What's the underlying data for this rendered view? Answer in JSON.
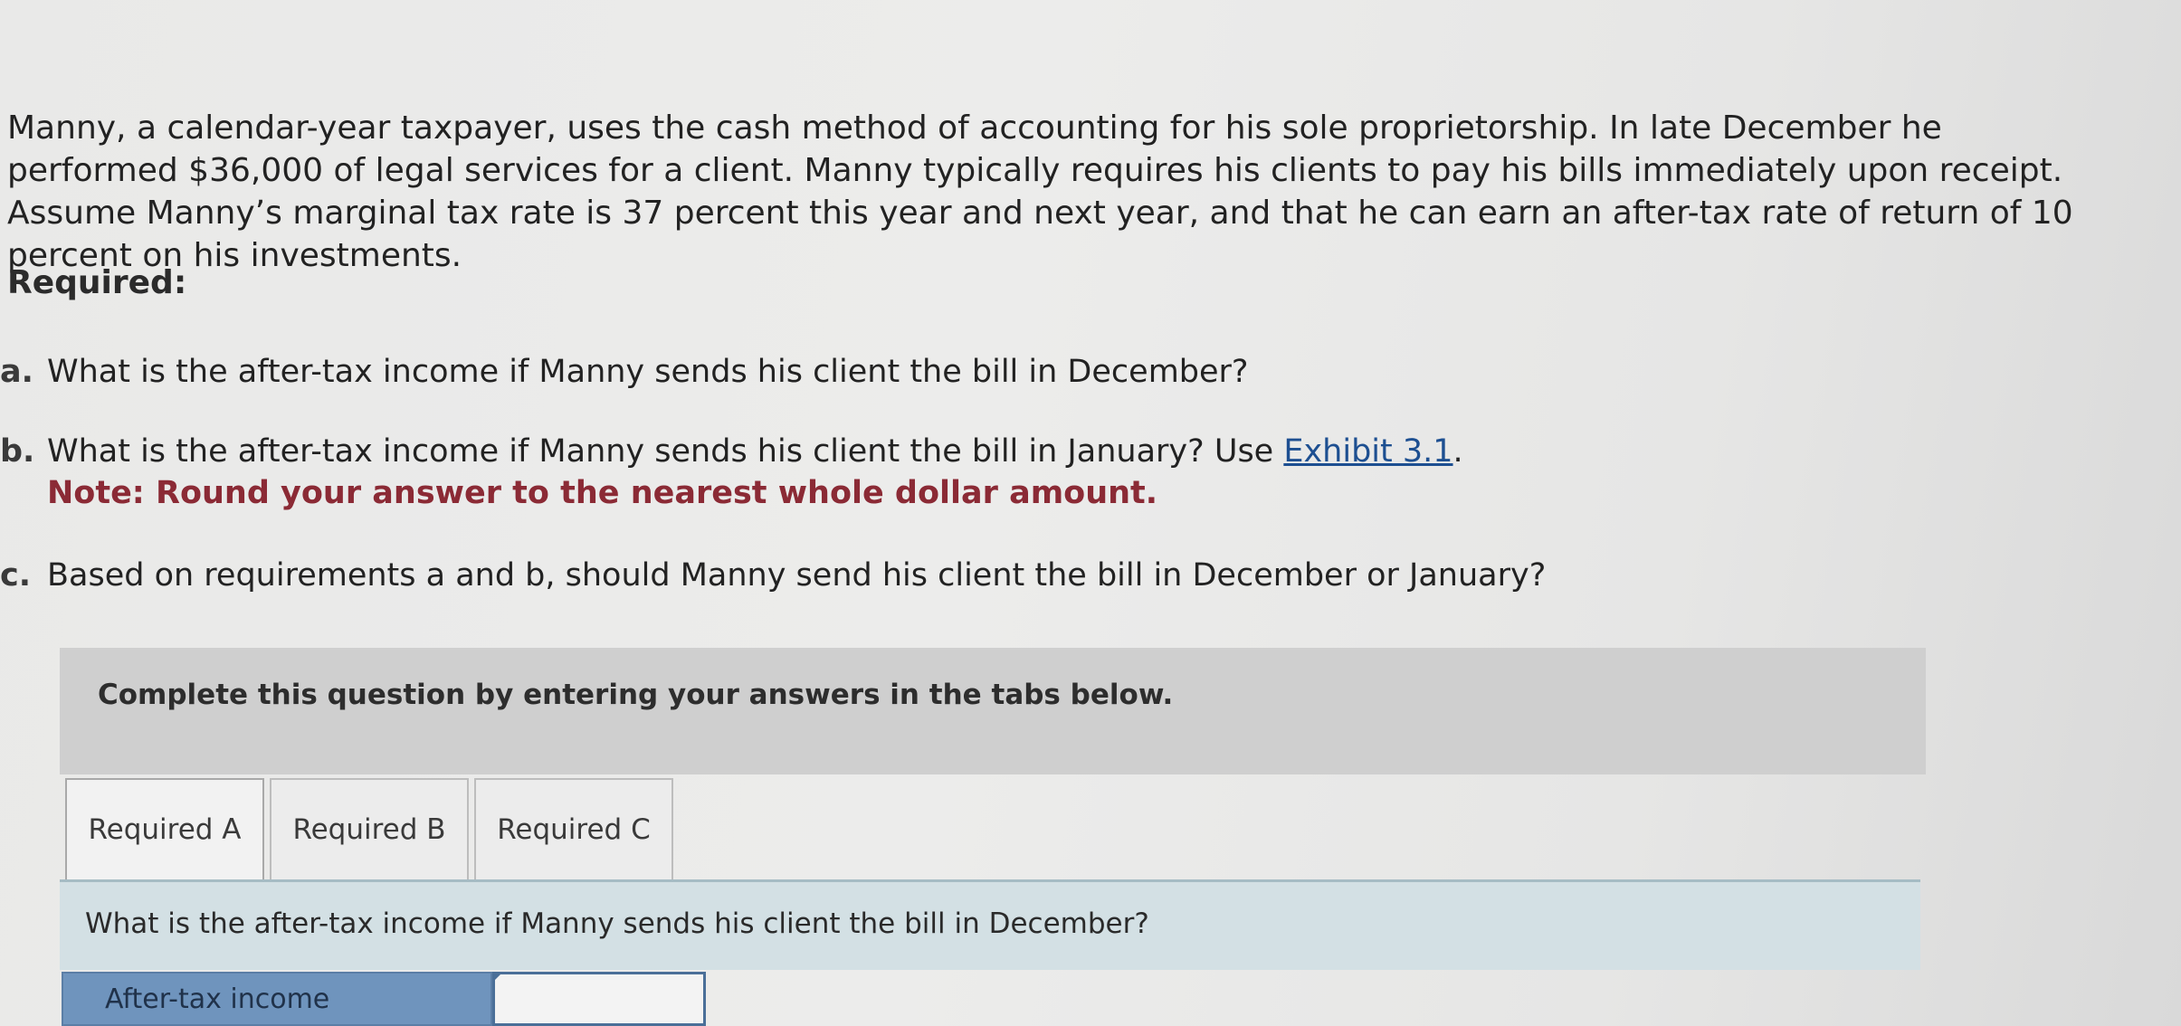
{
  "problem": {
    "intro": "Manny, a calendar-year taxpayer, uses the cash method of accounting for his sole proprietorship. In late December he performed $36,000 of legal services for a client. Manny typically requires his clients to pay his bills immediately upon receipt. Assume Manny’s marginal tax rate is 37 percent this year and next year, and that he can earn an after-tax rate of return of 10 percent on his investments.",
    "required_heading": "Required:",
    "items": [
      {
        "letter": "a.",
        "text": "What is the after-tax income if Manny sends his client the bill in December?"
      },
      {
        "letter": "b.",
        "text": "What is the after-tax income if Manny sends his client the bill in January? Use ",
        "link_text": "Exhibit 3.1",
        "after_link": ".",
        "note": "Note: Round your answer to the nearest whole dollar amount."
      },
      {
        "letter": "c.",
        "text": "Based on requirements a and b, should Manny send his client the bill in December or January?"
      }
    ]
  },
  "instruction": "Complete this question by entering your answers in the tabs below.",
  "tabs": [
    {
      "label": "Required A",
      "active": true
    },
    {
      "label": "Required B",
      "active": false
    },
    {
      "label": "Required C",
      "active": false
    }
  ],
  "question": "What is the after-tax income if Manny sends his client the bill in December?",
  "answer": {
    "label": "After-tax income",
    "value": ""
  },
  "colors": {
    "note": "#8b2a35",
    "link": "#1d4f91",
    "answer_label_bg": "#6f94bd",
    "question_bg": "#d3e0e4"
  }
}
